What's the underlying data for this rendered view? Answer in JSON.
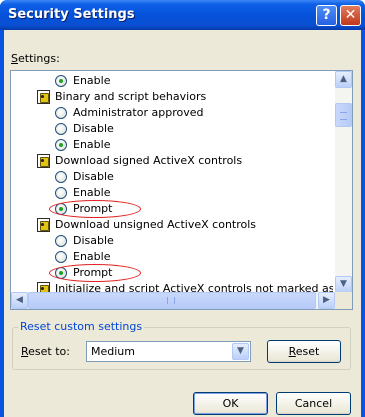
{
  "window": {
    "title": "Security Settings",
    "help_glyph": "?",
    "close_glyph": "✕"
  },
  "settings_label_prefix": "S",
  "settings_label_rest": "ettings:",
  "list": {
    "rows": [
      {
        "type": "option",
        "label": "Enable",
        "checked": true
      },
      {
        "type": "category",
        "label": "Binary and script behaviors"
      },
      {
        "type": "option",
        "label": "Administrator approved",
        "checked": false
      },
      {
        "type": "option",
        "label": "Disable",
        "checked": false
      },
      {
        "type": "option",
        "label": "Enable",
        "checked": true
      },
      {
        "type": "category",
        "label": "Download signed ActiveX controls"
      },
      {
        "type": "option",
        "label": "Disable",
        "checked": false
      },
      {
        "type": "option",
        "label": "Enable",
        "checked": false
      },
      {
        "type": "option",
        "label": "Prompt",
        "checked": true,
        "highlighted": true
      },
      {
        "type": "category",
        "label": "Download unsigned ActiveX controls"
      },
      {
        "type": "option",
        "label": "Disable",
        "checked": false
      },
      {
        "type": "option",
        "label": "Enable",
        "checked": false
      },
      {
        "type": "option",
        "label": "Prompt",
        "checked": true,
        "highlighted": true
      },
      {
        "type": "category",
        "label": "Initialize and script ActiveX controls not marked as safe"
      }
    ],
    "highlight_color": "#e22222"
  },
  "reset_group": {
    "title": "Reset custom settings",
    "reset_to_prefix": "R",
    "reset_to_rest": "eset to:",
    "selected_value": "Medium",
    "reset_button_prefix": "R",
    "reset_button_rest": "eset"
  },
  "buttons": {
    "ok": "OK",
    "cancel": "Cancel"
  },
  "colors": {
    "title_bar": "#0551d8",
    "dialog_bg": "#ece9d8",
    "group_title": "#0046d5"
  }
}
